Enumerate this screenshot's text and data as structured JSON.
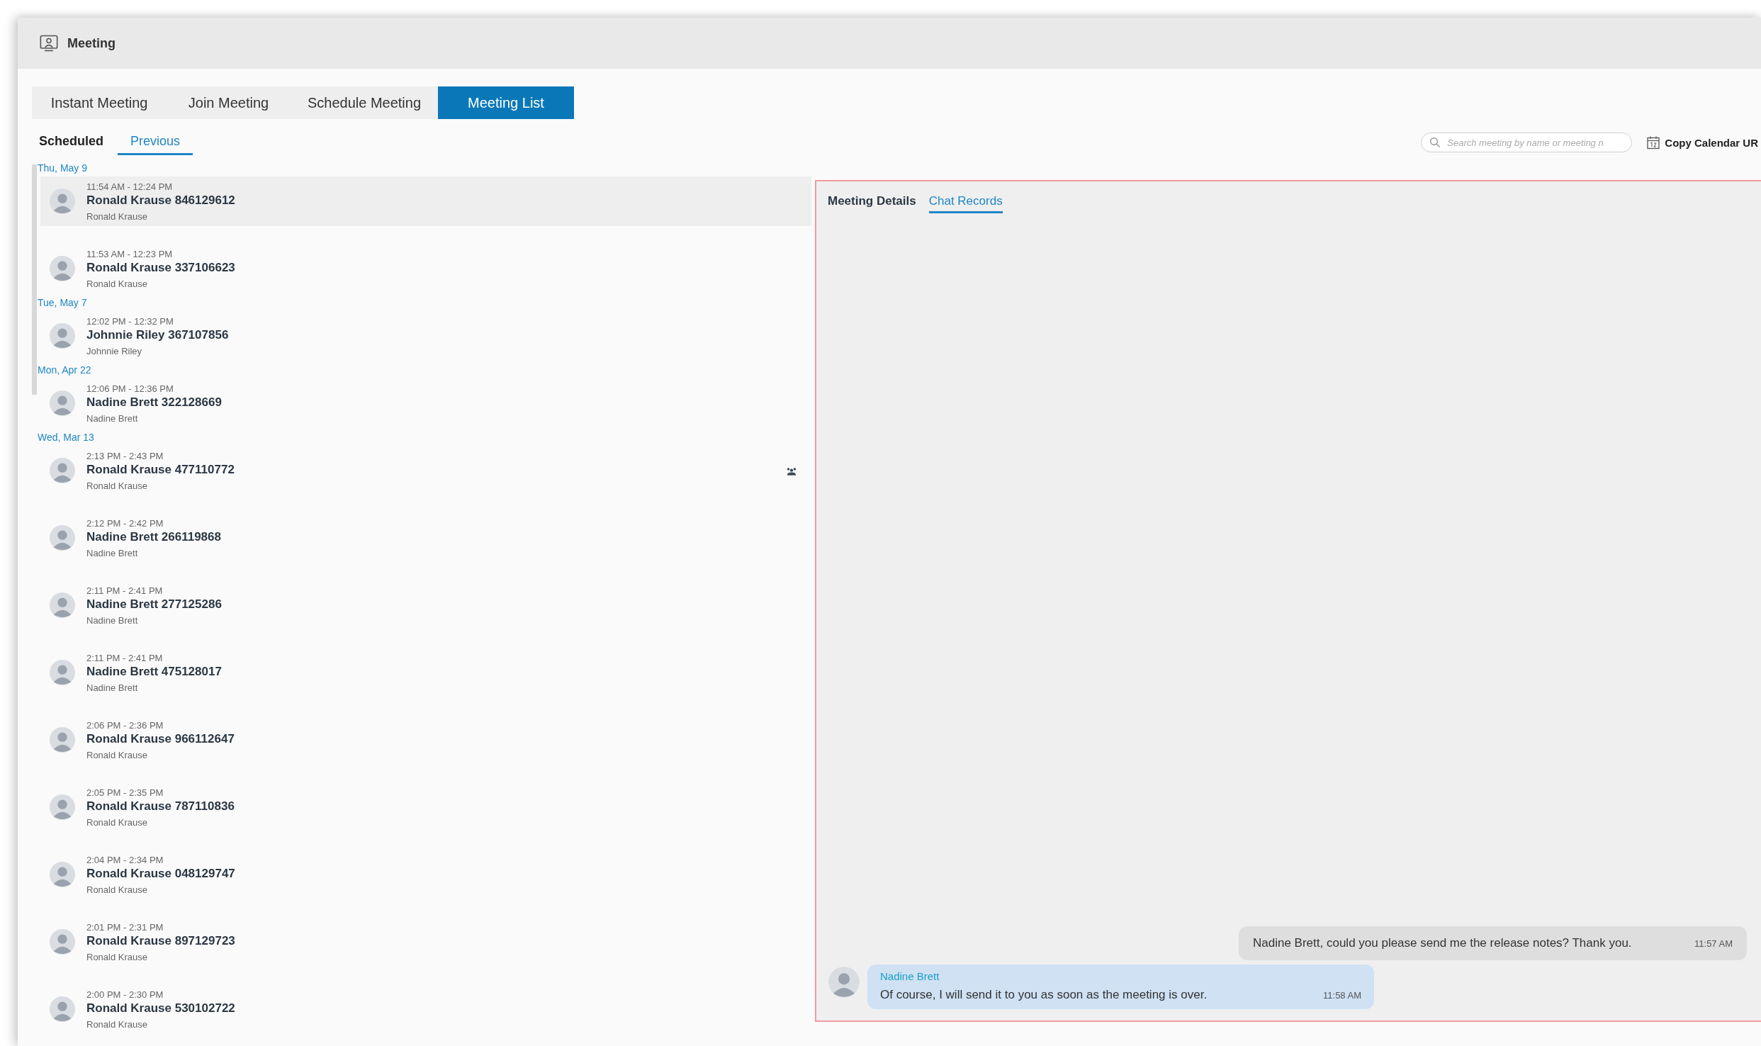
{
  "window": {
    "title": "Meeting"
  },
  "tabs": [
    {
      "label": "Instant Meeting",
      "selected": false
    },
    {
      "label": "Join Meeting",
      "selected": false
    },
    {
      "label": "Schedule Meeting",
      "selected": false
    },
    {
      "label": "Meeting List",
      "selected": true
    }
  ],
  "subtabs": [
    {
      "label": "Scheduled",
      "selected": false
    },
    {
      "label": "Previous",
      "selected": true
    }
  ],
  "search": {
    "placeholder": "Search meeting by name or meeting n"
  },
  "copy_calendar": {
    "label": "Copy Calendar UR"
  },
  "groups": [
    {
      "date": "Thu, May 9",
      "meetings": [
        {
          "time": "11:54 AM - 12:24 PM",
          "title": "Ronald Krause 846129612",
          "host": "Ronald Krause",
          "selected": true,
          "participants_icon": false
        },
        {
          "time": "11:53 AM - 12:23 PM",
          "title": "Ronald Krause 337106623",
          "host": "Ronald Krause",
          "selected": false,
          "participants_icon": false
        }
      ]
    },
    {
      "date": "Tue, May 7",
      "meetings": [
        {
          "time": "12:02 PM - 12:32 PM",
          "title": "Johnnie Riley 367107856",
          "host": "Johnnie Riley",
          "selected": false,
          "participants_icon": false
        }
      ]
    },
    {
      "date": "Mon, Apr 22",
      "meetings": [
        {
          "time": "12:06 PM - 12:36 PM",
          "title": "Nadine Brett 322128669",
          "host": "Nadine Brett",
          "selected": false,
          "participants_icon": false
        }
      ]
    },
    {
      "date": "Wed, Mar 13",
      "meetings": [
        {
          "time": "2:13 PM - 2:43 PM",
          "title": "Ronald Krause 477110772",
          "host": "Ronald Krause",
          "selected": false,
          "participants_icon": true
        },
        {
          "time": "2:12 PM - 2:42 PM",
          "title": "Nadine Brett 266119868",
          "host": "Nadine Brett",
          "selected": false,
          "participants_icon": false
        },
        {
          "time": "2:11 PM - 2:41 PM",
          "title": "Nadine Brett 277125286",
          "host": "Nadine Brett",
          "selected": false,
          "participants_icon": false
        },
        {
          "time": "2:11 PM - 2:41 PM",
          "title": "Nadine Brett 475128017",
          "host": "Nadine Brett",
          "selected": false,
          "participants_icon": false
        },
        {
          "time": "2:06 PM - 2:36 PM",
          "title": "Ronald Krause 966112647",
          "host": "Ronald Krause",
          "selected": false,
          "participants_icon": false
        },
        {
          "time": "2:05 PM - 2:35 PM",
          "title": "Ronald Krause 787110836",
          "host": "Ronald Krause",
          "selected": false,
          "participants_icon": false
        },
        {
          "time": "2:04 PM - 2:34 PM",
          "title": "Ronald Krause 048129747",
          "host": "Ronald Krause",
          "selected": false,
          "participants_icon": false
        },
        {
          "time": "2:01 PM - 2:31 PM",
          "title": "Ronald Krause 897129723",
          "host": "Ronald Krause",
          "selected": false,
          "participants_icon": false
        },
        {
          "time": "2:00 PM - 2:30 PM",
          "title": "Ronald Krause 530102722",
          "host": "Ronald Krause",
          "selected": false,
          "participants_icon": false
        }
      ]
    }
  ],
  "detail_tabs": [
    {
      "label": "Meeting Details",
      "selected": false
    },
    {
      "label": "Chat Records",
      "selected": true
    }
  ],
  "messages": [
    {
      "kind": "sent",
      "text": "Nadine Brett, could you please send me the release notes? Thank you.",
      "time": "11:57 AM"
    },
    {
      "kind": "received",
      "sender": "Nadine Brett",
      "text": "Of course, I will send it to you as soon as the meeting is over.",
      "time": "11:58 AM"
    }
  ]
}
